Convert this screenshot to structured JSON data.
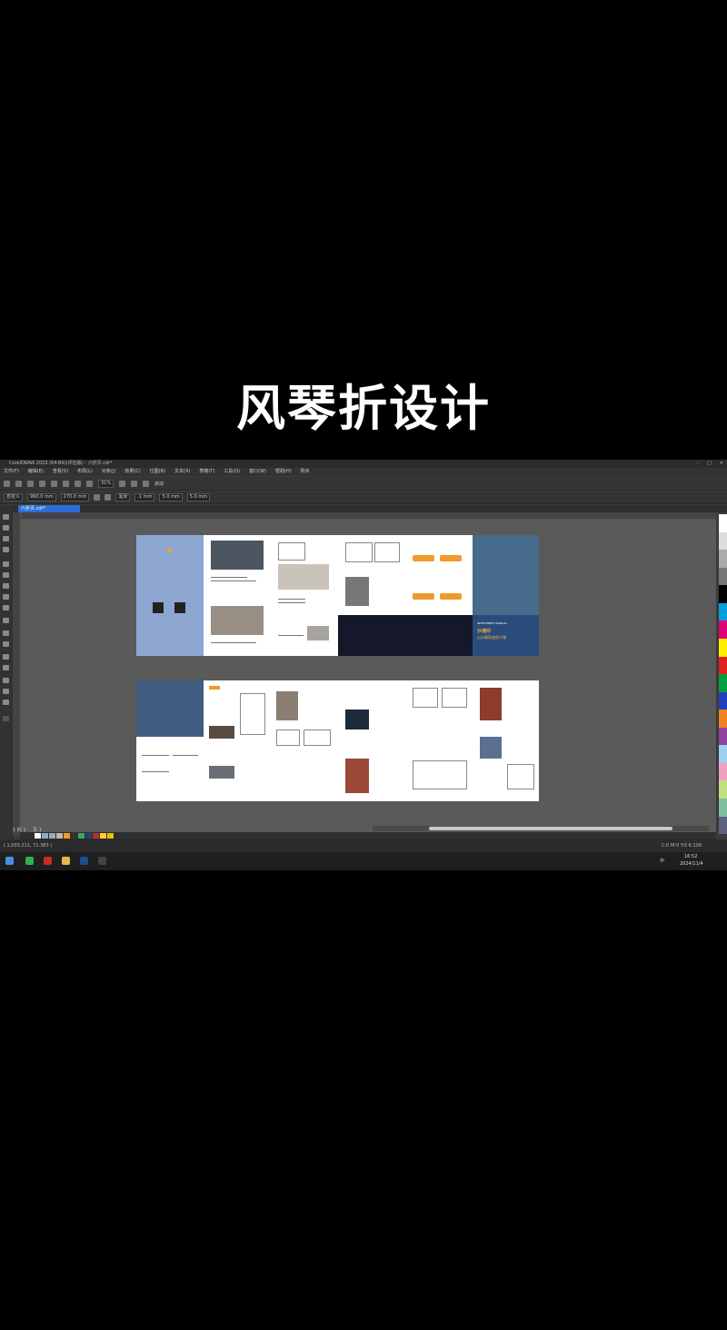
{
  "video_title": "风琴折设计",
  "app": {
    "window_title": "CorelDRAW 2023 (64-Bit)(评估版) - 六折页.cdr*",
    "menu": [
      "文件(F)",
      "编辑(E)",
      "查看(V)",
      "布局(L)",
      "对象(J)",
      "效果(C)",
      "位图(B)",
      "文本(X)",
      "表格(T)",
      "工具(O)",
      "窗口(W)",
      "帮助(H)",
      "购买"
    ],
    "toolbar": {
      "zoom": "31%",
      "launch": "启动"
    },
    "propbar": {
      "preset": "自定义",
      "width": "960.0 mm",
      "height": "270.0 mm",
      "units": "毫米",
      "nudge": ".1 mm",
      "dup_x": "5.0 mm",
      "dup_y": "5.0 mm"
    },
    "doc_tab": "六折页.cdr*",
    "page_nav": "1 的 1",
    "page_tab": "页 1",
    "status_left": "( 1,003.211, 71.383 )",
    "status_right": "C:0 M:0 Y:0 K:100",
    "taskbar": {
      "time": "16:52",
      "date": "2024/11/4",
      "lang": "中"
    },
    "spread_top": {
      "cover_label": "INVESTMENT MANUAL",
      "cover_title": "沙渚印",
      "cover_subtitle": "山水康养度假小镇"
    }
  }
}
